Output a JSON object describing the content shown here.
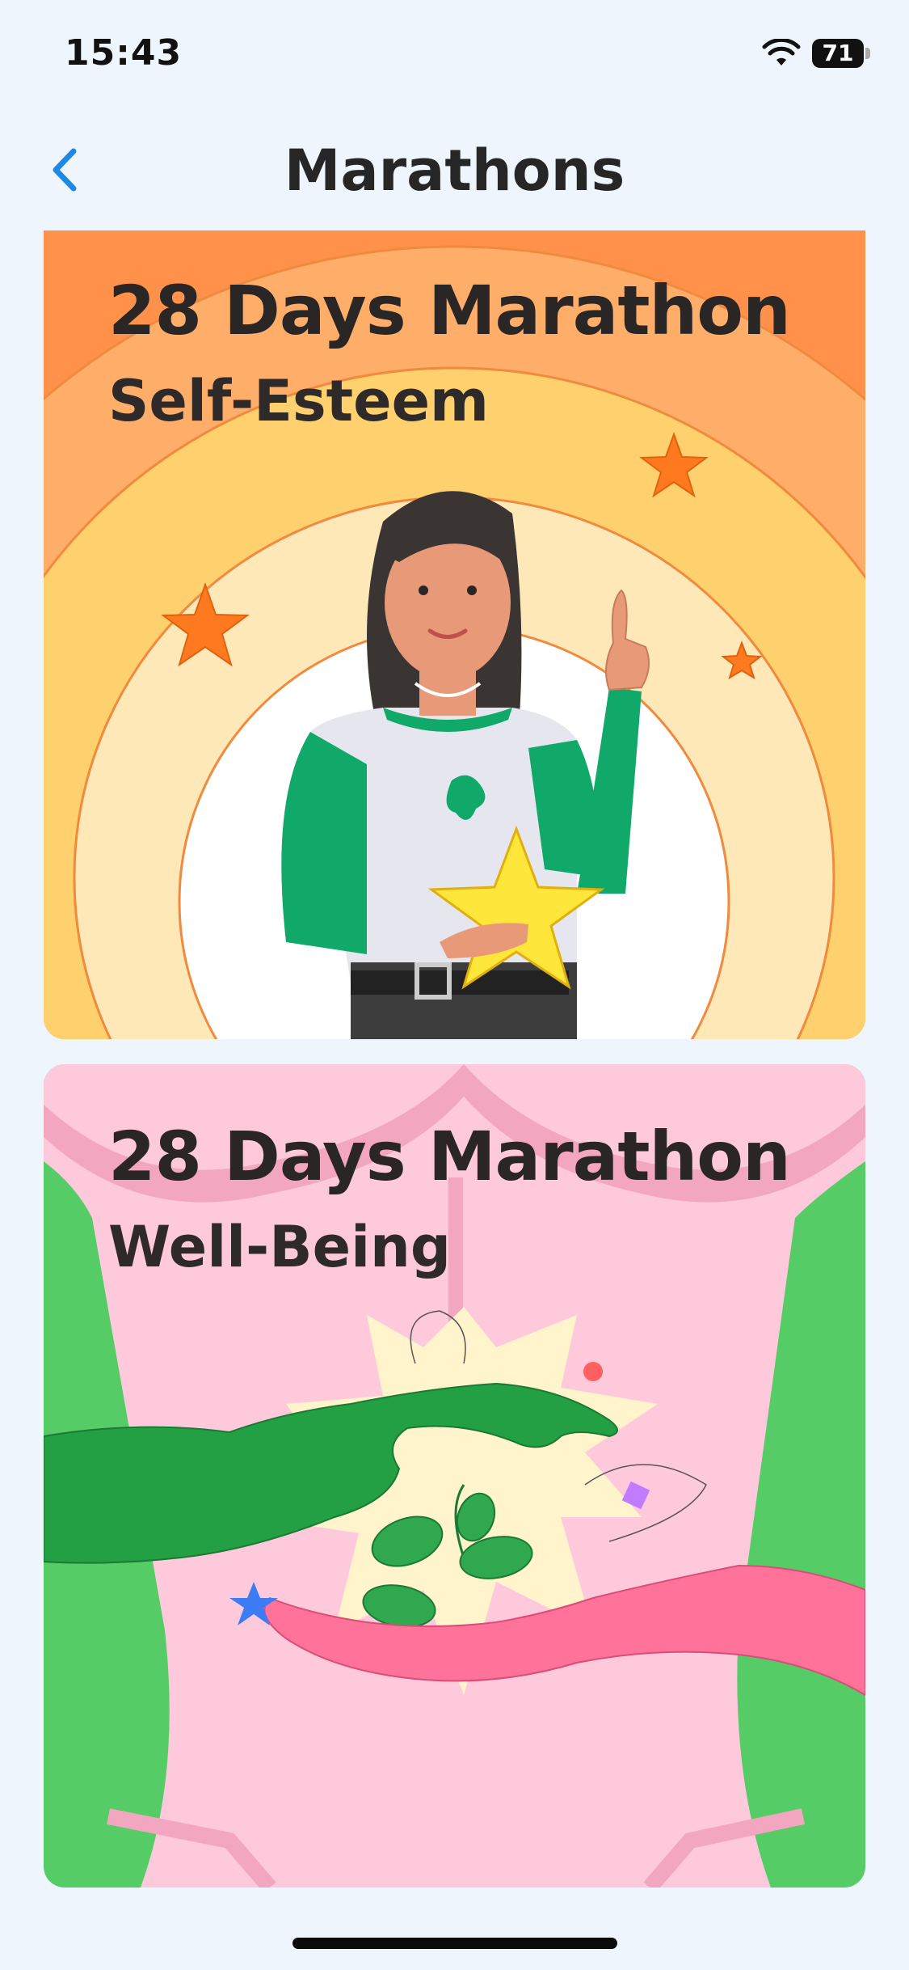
{
  "status_bar": {
    "time": "15:43",
    "battery": "71"
  },
  "nav": {
    "title": "Marathons"
  },
  "marathons": [
    {
      "title": "28 Days Marathon",
      "subtitle": "Self-Esteem"
    },
    {
      "title": "28 Days Marathon",
      "subtitle": "Well-Being"
    }
  ],
  "icons": {
    "back": "chevron-left-icon",
    "wifi": "wifi-icon",
    "battery": "battery-icon"
  },
  "colors": {
    "background": "#eef5fd",
    "accent": "#1e88e5",
    "card1_orange": "#ff914a",
    "card2_pink": "#ffc9dc",
    "card2_green": "#55cc66"
  }
}
